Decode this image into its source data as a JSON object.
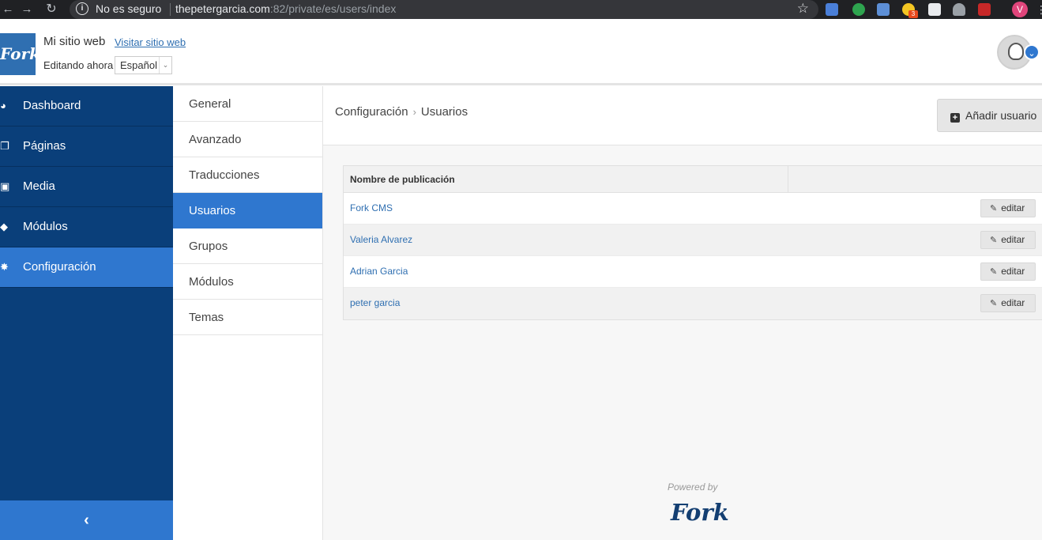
{
  "browser": {
    "security_label": "No es seguro",
    "url_host": "thepetergarcia.com",
    "url_path": ":82/private/es/users/index",
    "profile_initial": "V",
    "extension_badge": "3"
  },
  "header": {
    "logo_text": "Fork",
    "site_name": "Mi sitio web",
    "visit_link": "Visitar sitio web",
    "editing_label": "Editando ahora",
    "language": "Español"
  },
  "sidebar": {
    "items": [
      {
        "label": "Dashboard",
        "icon": "dashboard-icon",
        "active": false
      },
      {
        "label": "Páginas",
        "icon": "pages-icon",
        "active": false
      },
      {
        "label": "Media",
        "icon": "image-icon",
        "active": false
      },
      {
        "label": "Módulos",
        "icon": "cube-icon",
        "active": false
      },
      {
        "label": "Configuración",
        "icon": "gear-icon",
        "active": true
      }
    ],
    "collapse_icon": "chevron-left-icon"
  },
  "subnav": {
    "items": [
      {
        "label": "General",
        "active": false
      },
      {
        "label": "Avanzado",
        "active": false
      },
      {
        "label": "Traducciones",
        "active": false
      },
      {
        "label": "Usuarios",
        "active": true
      },
      {
        "label": "Grupos",
        "active": false
      },
      {
        "label": "Módulos",
        "active": false
      },
      {
        "label": "Temas",
        "active": false
      }
    ]
  },
  "main": {
    "breadcrumb": [
      "Configuración",
      "Usuarios"
    ],
    "add_button": "Añadir usuario",
    "table": {
      "header": "Nombre de publicación",
      "rows": [
        {
          "name": "Fork CMS",
          "action": "editar"
        },
        {
          "name": "Valeria Alvarez",
          "action": "editar"
        },
        {
          "name": "Adrian Garcia",
          "action": "editar"
        },
        {
          "name": "peter garcia",
          "action": "editar"
        }
      ]
    }
  },
  "footer": {
    "powered_by": "Powered by",
    "logo_text": "Fork"
  },
  "colors": {
    "sidebar_bg": "#0a3f7a",
    "accent_blue": "#2f77cf",
    "link_blue": "#2f6fb1"
  }
}
